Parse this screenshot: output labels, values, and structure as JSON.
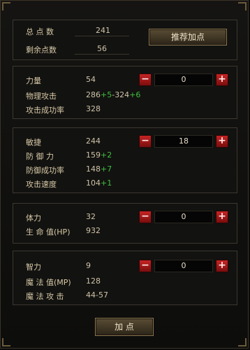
{
  "summary": {
    "total_points_label": "总 点 数",
    "total_points_value": "241",
    "remaining_points_label": "剩余点数",
    "remaining_points_value": "56",
    "recommend_button": "推荐加点"
  },
  "strength": {
    "label": "力量",
    "value": "54",
    "alloc": "0",
    "rows": [
      {
        "label": "物理攻击",
        "base": "286",
        "bonus": "+5",
        "mid": "-324",
        "bonus2": "+6"
      },
      {
        "label": "攻击成功率",
        "base": "328"
      }
    ]
  },
  "agility": {
    "label": "敏捷",
    "value": "244",
    "alloc": "18",
    "rows": [
      {
        "label": "防 御 力",
        "base": "159",
        "bonus": "+2"
      },
      {
        "label": "防御成功率",
        "base": "148",
        "bonus": "+7"
      },
      {
        "label": "攻击速度",
        "base": "104",
        "bonus": "+1"
      }
    ]
  },
  "vitality": {
    "label": "体力",
    "value": "32",
    "alloc": "0",
    "rows": [
      {
        "label": "生 命 值(HP)",
        "base": "932"
      }
    ]
  },
  "intelligence": {
    "label": "智力",
    "value": "9",
    "alloc": "0",
    "rows": [
      {
        "label": "魔 法 值(MP)",
        "base": "128"
      },
      {
        "label": "魔 法 攻 击",
        "base": "44-57"
      }
    ]
  },
  "stepper_symbols": {
    "minus": "−",
    "plus": "+"
  },
  "footer": {
    "add_button": "加 点"
  }
}
